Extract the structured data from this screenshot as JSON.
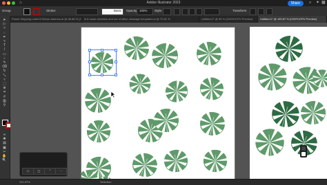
{
  "window": {
    "title": "Adobe Illustrator 2023",
    "share_label": "Share"
  },
  "control_bar": {
    "selection_label": "Group",
    "stroke_label": "Stroke:",
    "brush_label": "Basic",
    "opacity_label": "Opacity:",
    "opacity_value": "100%",
    "style_label": "Style:",
    "transform_label": "Transform"
  },
  "tabs": [
    {
      "label": "Planet Shipping Label 8 Return Address.ai @ 66.68 % (CMYK/CPU Preview)",
      "active": false
    },
    {
      "label": "lit & iusse clothbles and out of office message templates.ai @ 72.81 %",
      "active": false
    },
    {
      "label": "Untitled-2* @ 69 % (CMYK/CPU Preview)",
      "active": false
    },
    {
      "label": "Untitled-1* @ 109.87 % (CMYK/CPU Preview)",
      "active": true
    }
  ],
  "status_bar": {
    "zoom": "101.87%",
    "tool": "Selection"
  },
  "colors": {
    "leaf": "#5f9a6a",
    "leaf_dark": "#2e6b43",
    "selection": "#4a7cff",
    "accent": "#1473e6"
  },
  "tools": [
    "selection-icon",
    "direct-selection-icon",
    "magic-wand-icon",
    "lasso-icon",
    "pen-icon",
    "curvature-icon",
    "type-icon",
    "line-icon",
    "rectangle-icon",
    "paintbrush-icon",
    "pencil-icon",
    "eraser-icon",
    "rotate-icon",
    "scale-icon",
    "width-icon",
    "free-transform-icon",
    "shape-builder-icon",
    "perspective-icon",
    "mesh-icon",
    "gradient-icon",
    "eyedropper-icon",
    "blend-icon",
    "symbol-sprayer-icon",
    "graph-icon",
    "artboard-icon",
    "slice-icon",
    "hand-icon",
    "zoom-icon"
  ]
}
